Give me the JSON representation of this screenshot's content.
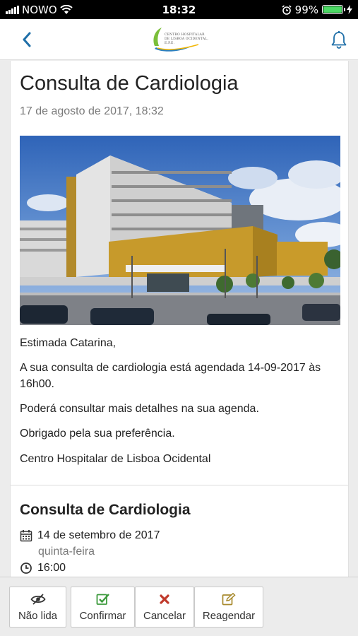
{
  "status_bar": {
    "carrier": "NOWO",
    "time": "18:32",
    "battery_percent": "99%",
    "battery_level": 0.99,
    "icons": [
      "signal-icon",
      "wifi-icon",
      "alarm-icon",
      "battery-icon",
      "charging-icon"
    ]
  },
  "nav": {
    "back_icon": "chevron-left-icon",
    "logo_text": "CENTRO HOSPITALAR DE LISBOA OCIDENTAL, E.P.E.",
    "bell_icon": "bell-icon",
    "accent": "#1f6fa8"
  },
  "message": {
    "title": "Consulta de Cardiologia",
    "date": "17 de agosto de 2017, 18:32",
    "paragraphs": [
      "Estimada Catarina,",
      "A sua consulta de cardiologia está agendada 14-09-2017 às 16h00.",
      "Poderá consultar mais detalhes na sua agenda.",
      "Obrigado pela sua preferência.",
      "Centro Hospitalar de Lisboa Ocidental"
    ]
  },
  "appointment": {
    "title": "Consulta de Cardiologia",
    "date": "14 de setembro de 2017",
    "weekday": "quinta-feira",
    "time": "16:00",
    "date_icon": "calendar-icon",
    "time_icon": "clock-icon"
  },
  "toolbar": {
    "buttons": [
      {
        "label": "Não lida",
        "icon": "eye-slash-icon",
        "color": "#333333"
      },
      {
        "label": "Confirmar",
        "icon": "check-square-icon",
        "color": "#3c9a3c"
      },
      {
        "label": "Cancelar",
        "icon": "x-icon",
        "color": "#c0392b"
      },
      {
        "label": "Reagendar",
        "icon": "edit-icon",
        "color": "#a88a2e"
      }
    ]
  }
}
